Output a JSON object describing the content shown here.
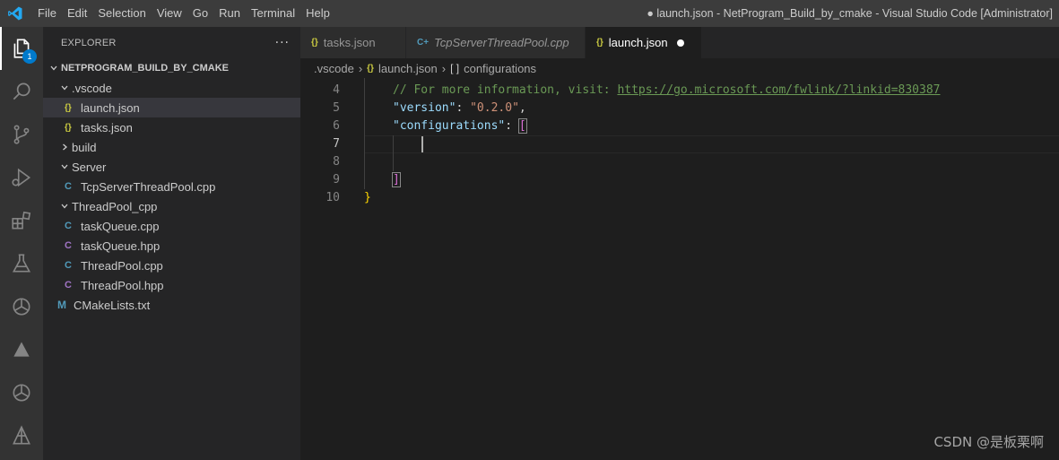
{
  "titlebar": {
    "menu": [
      "File",
      "Edit",
      "Selection",
      "View",
      "Go",
      "Run",
      "Terminal",
      "Help"
    ],
    "window_title": "● launch.json - NetProgram_Build_by_cmake - Visual Studio Code [Administrator]"
  },
  "activitybar": {
    "explorer_badge": "1",
    "icons": [
      "files-icon",
      "search-icon",
      "source-control-icon",
      "run-debug-icon",
      "extensions-icon",
      "testing-icon",
      "openai-icon",
      "triangle-extension-icon",
      "openai-icon",
      "feather-extension-icon"
    ]
  },
  "sidebar": {
    "title": "EXPLORER",
    "more": "···",
    "project": "NETPROGRAM_BUILD_BY_CMAKE",
    "tree": [
      {
        "label": ".vscode",
        "type": "folder",
        "expanded": true,
        "depth": 1
      },
      {
        "label": "launch.json",
        "type": "json",
        "depth": 2,
        "selected": true
      },
      {
        "label": "tasks.json",
        "type": "json",
        "depth": 2
      },
      {
        "label": "build",
        "type": "folder",
        "expanded": false,
        "depth": 1
      },
      {
        "label": "Server",
        "type": "folder",
        "expanded": true,
        "depth": 1
      },
      {
        "label": "TcpServerThreadPool.cpp",
        "type": "cpp",
        "depth": 2
      },
      {
        "label": "ThreadPool_cpp",
        "type": "folder",
        "expanded": true,
        "depth": 1
      },
      {
        "label": "taskQueue.cpp",
        "type": "cpp",
        "depth": 2
      },
      {
        "label": "taskQueue.hpp",
        "type": "hpp",
        "depth": 2
      },
      {
        "label": "ThreadPool.cpp",
        "type": "cpp",
        "depth": 2
      },
      {
        "label": "ThreadPool.hpp",
        "type": "hpp",
        "depth": 2
      },
      {
        "label": "CMakeLists.txt",
        "type": "cmake",
        "depth": 1
      }
    ]
  },
  "tabs": [
    {
      "label": "tasks.json",
      "icon": "{}",
      "kind": "json",
      "active": false,
      "italic": false,
      "dirty": false
    },
    {
      "label": "TcpServerThreadPool.cpp",
      "icon": "C+",
      "kind": "cpp",
      "active": false,
      "italic": true,
      "dirty": false
    },
    {
      "label": "launch.json",
      "icon": "{}",
      "kind": "json",
      "active": true,
      "italic": false,
      "dirty": true
    }
  ],
  "breadcrumbs": {
    "folder": ".vscode",
    "file": "launch.json",
    "file_icon": "{}",
    "symbol_icon": "[ ]",
    "symbol": "configurations"
  },
  "code": {
    "lines": [
      {
        "n": "4",
        "tokens": [
          {
            "t": "// For more information, visit: ",
            "c": "c-comment"
          },
          {
            "t": "https://go.microsoft.com/fwlink/?linkid=830387",
            "c": "c-link"
          }
        ],
        "indent": 1
      },
      {
        "n": "5",
        "tokens": [
          {
            "t": "\"version\"",
            "c": "c-key"
          },
          {
            "t": ": ",
            "c": ""
          },
          {
            "t": "\"0.2.0\"",
            "c": "c-str"
          },
          {
            "t": ",",
            "c": ""
          }
        ],
        "indent": 1
      },
      {
        "n": "6",
        "tokens": [
          {
            "t": "\"configurations\"",
            "c": "c-key"
          },
          {
            "t": ": ",
            "c": ""
          },
          {
            "t": "[",
            "c": "c-bracket"
          }
        ],
        "indent": 1
      },
      {
        "n": "7",
        "tokens": [],
        "indent": 2,
        "current": true
      },
      {
        "n": "8",
        "tokens": [],
        "indent": 0
      },
      {
        "n": "9",
        "tokens": [
          {
            "t": "]",
            "c": "c-bracket"
          }
        ],
        "indent": 1
      },
      {
        "n": "10",
        "tokens": [
          {
            "t": "}",
            "c": "c-brace"
          }
        ],
        "indent": 0
      }
    ]
  },
  "watermark": "CSDN @是板栗啊",
  "colors": {
    "accent": "#007acc",
    "json_icon": "#cbcb41",
    "cpp_icon": "#519aba",
    "hpp_icon": "#a074c4",
    "comment": "#6a9955",
    "key": "#9cdcfe",
    "string": "#ce9178"
  }
}
